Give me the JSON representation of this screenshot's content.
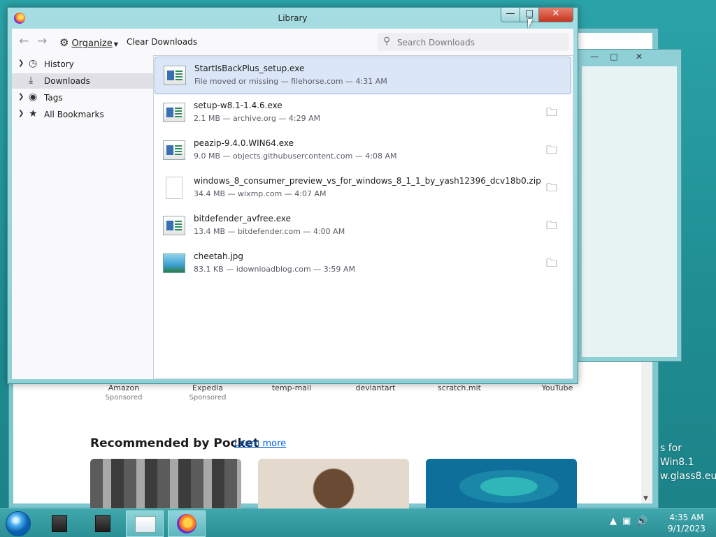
{
  "background_window": {
    "toolbar_icons": [
      "pocket-icon",
      "extensions-icon",
      "menu-icon"
    ],
    "shortcuts": [
      {
        "name": "Amazon",
        "sub": "Sponsored"
      },
      {
        "name": "Expedia",
        "sub": "Sponsored"
      },
      {
        "name": "temp-mail",
        "sub": ""
      },
      {
        "name": "deviantart",
        "sub": ""
      },
      {
        "name": "scratch.mit",
        "sub": ""
      },
      {
        "name": "YouTube",
        "sub": ""
      }
    ],
    "pocket_title": "Recommended by Pocket",
    "pocket_link": "Learn more"
  },
  "desktop_text": {
    "line1": "s for Win8.1",
    "line2": "w.glass8.eu"
  },
  "library": {
    "title": "Library",
    "toolbar": {
      "organize": "Organize",
      "clear_downloads": "Clear Downloads",
      "search_placeholder": "Search Downloads"
    },
    "sidebar": [
      {
        "label": "History",
        "icon": "clock-icon",
        "twisty": true,
        "selected": false
      },
      {
        "label": "Downloads",
        "icon": "download-icon",
        "twisty": false,
        "selected": true
      },
      {
        "label": "Tags",
        "icon": "tag-icon",
        "twisty": true,
        "selected": false
      },
      {
        "label": "All Bookmarks",
        "icon": "star-icon",
        "twisty": true,
        "selected": false
      }
    ],
    "downloads": [
      {
        "name": "StartIsBackPlus_setup.exe",
        "status": "File moved or missing — filehorse.com — 4:31 AM",
        "type": "exe",
        "selected": true,
        "folder": false
      },
      {
        "name": "setup-w8.1-1.4.6.exe",
        "status": "2.1 MB — archive.org — 4:29 AM",
        "type": "exe",
        "selected": false,
        "folder": true
      },
      {
        "name": "peazip-9.4.0.WIN64.exe",
        "status": "9.0 MB — objects.githubusercontent.com — 4:08 AM",
        "type": "exe",
        "selected": false,
        "folder": true
      },
      {
        "name": "windows_8_consumer_preview_vs_for_windows_8_1_1_by_yash12396_dcv18b0.zip",
        "status": "34.4 MB — wixmp.com — 4:07 AM",
        "type": "zip",
        "selected": false,
        "folder": true
      },
      {
        "name": "bitdefender_avfree.exe",
        "status": "13.4 MB — bitdefender.com — 4:00 AM",
        "type": "exe",
        "selected": false,
        "folder": true
      },
      {
        "name": "cheetah.jpg",
        "status": "83.1 KB — idownloadblog.com — 3:59 AM",
        "type": "jpg",
        "selected": false,
        "folder": true
      }
    ]
  },
  "taskbar": {
    "clock_time": "4:35 AM",
    "clock_date": "9/1/2023"
  }
}
